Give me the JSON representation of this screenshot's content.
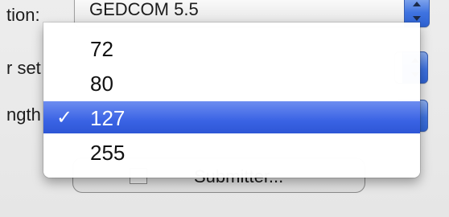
{
  "background": {
    "row1_label": "tion:",
    "row1_value": "GEDCOM 5.5",
    "row2_label": "r set",
    "row3_label": "ngth",
    "submitter_label": "Submitter..."
  },
  "menu": {
    "items": [
      {
        "label": "72"
      },
      {
        "label": "80"
      },
      {
        "label": "127"
      },
      {
        "label": "255"
      }
    ],
    "selected_index": 2,
    "check_glyph": "✓",
    "selected_color": "#3a63e4"
  }
}
